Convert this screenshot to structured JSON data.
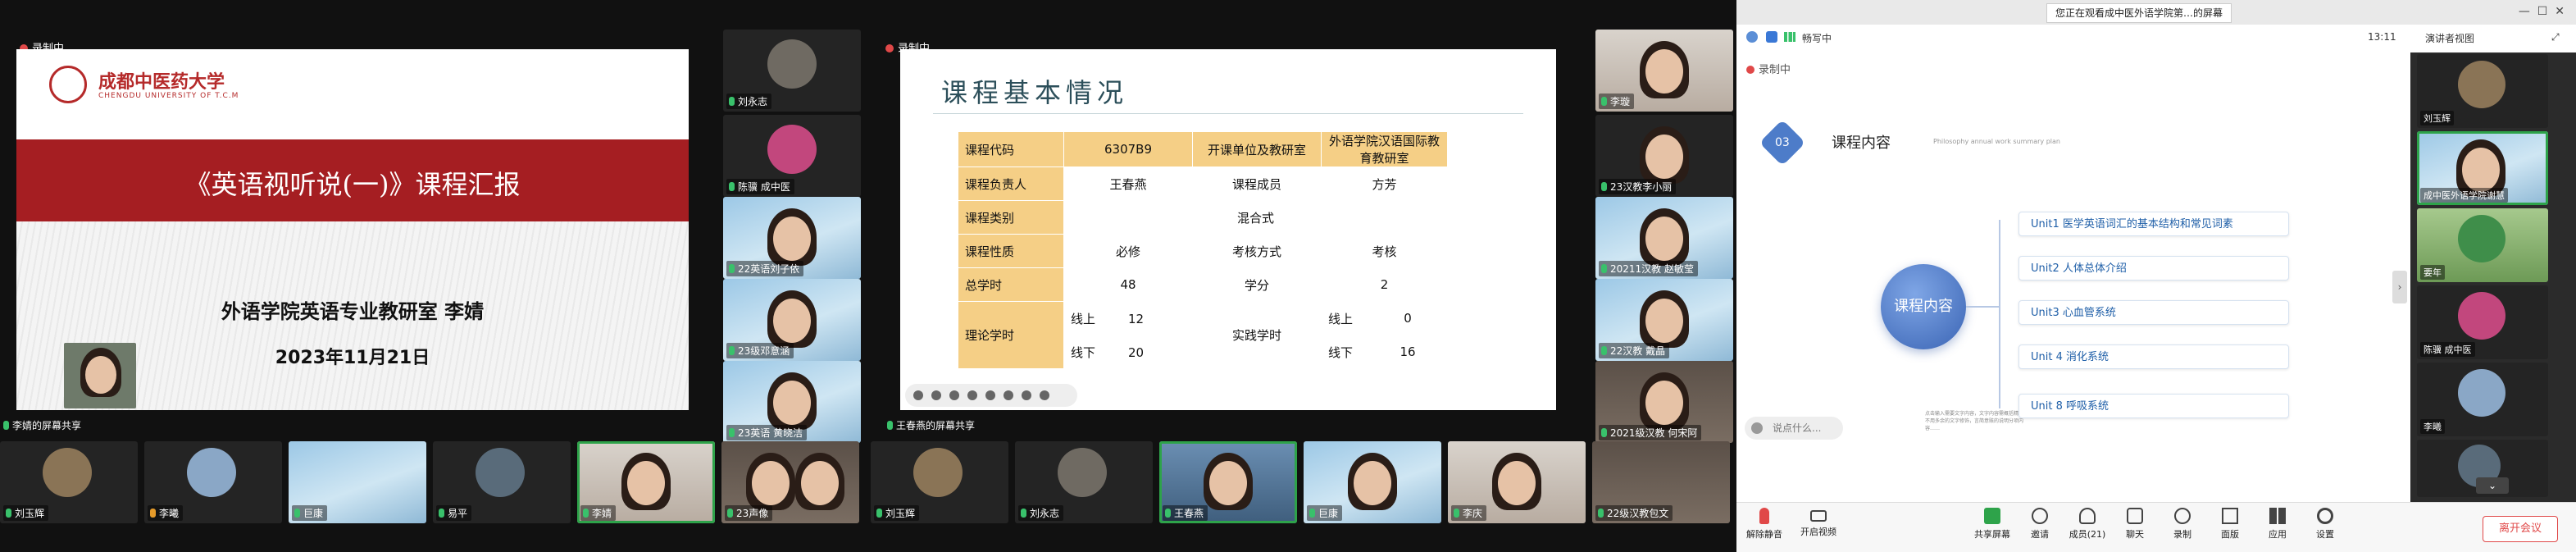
{
  "left_window": {
    "recording_label": "录制中"
  },
  "slide1": {
    "university_name": "成都中医药大学",
    "university_sub": "CHENGDU UNIVERSITY OF T.C.M",
    "title": "《英语视听说(一)》课程汇报",
    "author": "外语学院英语专业教研室  李婧",
    "date": "2023年11月21日",
    "share_label": "李婧的屏幕共享"
  },
  "mid_tiles": [
    {
      "label": "刘永志"
    },
    {
      "label": "陈骥 成中医"
    },
    {
      "label": "22英语刘子依"
    },
    {
      "label": "23级邓意涵"
    },
    {
      "label": "23英语 黄晓洁"
    }
  ],
  "slide2": {
    "recording_label": "录制中",
    "title": "课程基本情况",
    "rows": [
      [
        "课程代码",
        "6307B9",
        "开课单位及教研室",
        "外语学院汉语国际教育教研室"
      ],
      [
        "课程负责人",
        "王春燕",
        "课程成员",
        "方芳"
      ],
      [
        "课程类别",
        "混合式"
      ],
      [
        "课程性质",
        "必修",
        "考核方式",
        "考核"
      ],
      [
        "总学时",
        "48",
        "学分",
        "2"
      ],
      [
        "理论学时",
        "线上",
        "12",
        "实践学时",
        "线上",
        "0"
      ],
      [
        "",
        "线下",
        "20",
        "",
        "线下",
        "16"
      ]
    ],
    "share_label": "王春燕的屏幕共享"
  },
  "right_col_tiles": [
    {
      "label": "李璇"
    },
    {
      "label": "23汉教李小丽"
    },
    {
      "label": "20211汉教 赵敏莹"
    },
    {
      "label": "22汉教 戴晶"
    },
    {
      "label": "2021级汉教 何宋阿"
    }
  ],
  "bottom_tiles": [
    {
      "label": "刘玉辉"
    },
    {
      "label": "李曦"
    },
    {
      "label": "巨康"
    },
    {
      "label": "易平"
    },
    {
      "label": "李婧"
    },
    {
      "label": "23声像"
    },
    {
      "label": "刘玉辉"
    },
    {
      "label": "刘永志"
    },
    {
      "label": "王春燕"
    },
    {
      "label": "巨康"
    },
    {
      "label": "李庆"
    },
    {
      "label": "22级汉教包文"
    }
  ],
  "app": {
    "viewing_banner": "您正在观看成中医外语学院第…的屏幕",
    "caster_status": "畅写中",
    "time": "13:11",
    "speaker_view": "演讲者视图",
    "recording_label": "录制中",
    "slide": {
      "number": "03",
      "heading": "课程内容",
      "subheading": "Philosophy annual work summary plan",
      "center": "课程内容",
      "units": [
        "Unit1  医学英语词汇的基本结构和常见词素",
        "Unit2  人体总体介绍",
        "Unit3  心血管系统",
        "Unit 4  消化系统",
        "Unit 8  呼吸系统"
      ],
      "note": "点击输入需要文字内容，文字内容需概括精练，不用多余的文字修饰，言简意赅的说明分项内容……",
      "comment_placeholder": "说点什么..."
    },
    "side_tiles": [
      {
        "label": "刘玉辉"
      },
      {
        "label": "成中医外语学院谢慧"
      },
      {
        "label": "要年"
      },
      {
        "label": "陈骥 成中医"
      },
      {
        "label": "李曦"
      }
    ],
    "toolbar": {
      "mute": "解除静音",
      "video": "开启视频",
      "share": "共享屏幕",
      "invite": "邀请",
      "members": "成员(21)",
      "chat": "聊天",
      "record": "录制",
      "apps": "应用",
      "settings": "设置",
      "whiteboard": "面版",
      "leave": "离开会议"
    }
  },
  "colors": {
    "accent_green": "#2ea34a",
    "banner_red": "#a51e22",
    "table_header": "#f5cf86",
    "unit_blue": "#1f5fa8"
  }
}
